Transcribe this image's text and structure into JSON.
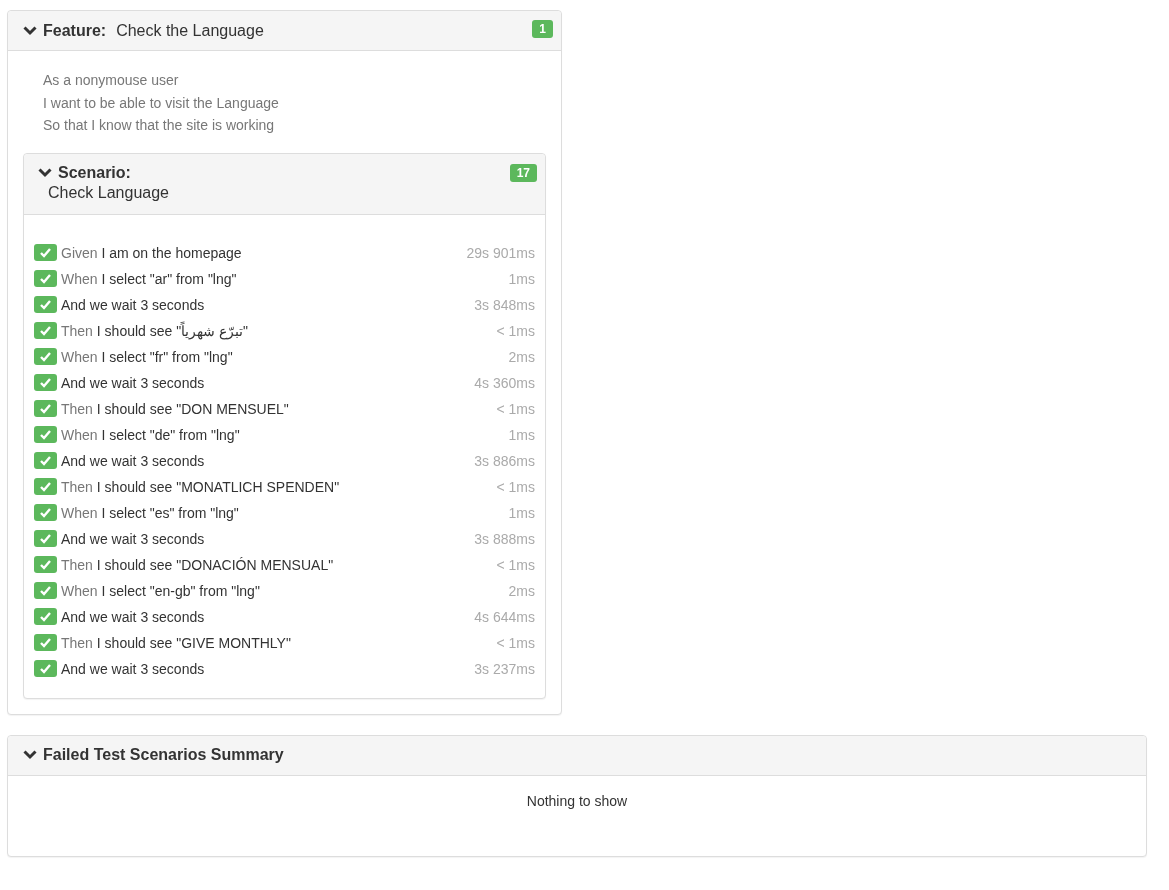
{
  "feature": {
    "label": "Feature:",
    "title": "Check the Language",
    "expanded": true,
    "count": "1",
    "description": [
      "As a nonymouse user",
      "I want to be able to visit the Language",
      "So that I know that the site is working"
    ],
    "scenario": {
      "label": "Scenario:",
      "title": "Check Language",
      "expanded": true,
      "count": "17",
      "steps": [
        {
          "kind": "given",
          "passed": true,
          "keyword": "Given",
          "text": "I am on the homepage",
          "duration": "29s 901ms"
        },
        {
          "kind": "when",
          "passed": true,
          "keyword": "When",
          "text": "I select \"ar\" from \"lng\"",
          "duration": "1ms"
        },
        {
          "kind": "and",
          "passed": true,
          "keyword": "And",
          "text": "we wait 3 seconds",
          "duration": "3s 848ms"
        },
        {
          "kind": "then",
          "passed": true,
          "keyword": "Then",
          "text": "I should see \"تبرّع شهرياً\"",
          "duration": "< 1ms"
        },
        {
          "kind": "when",
          "passed": true,
          "keyword": "When",
          "text": "I select \"fr\" from \"lng\"",
          "duration": "2ms"
        },
        {
          "kind": "and",
          "passed": true,
          "keyword": "And",
          "text": "we wait 3 seconds",
          "duration": "4s 360ms"
        },
        {
          "kind": "then",
          "passed": true,
          "keyword": "Then",
          "text": "I should see \"DON MENSUEL\"",
          "duration": "< 1ms"
        },
        {
          "kind": "when",
          "passed": true,
          "keyword": "When",
          "text": "I select \"de\" from \"lng\"",
          "duration": "1ms"
        },
        {
          "kind": "and",
          "passed": true,
          "keyword": "And",
          "text": "we wait 3 seconds",
          "duration": "3s 886ms"
        },
        {
          "kind": "then",
          "passed": true,
          "keyword": "Then",
          "text": "I should see \"MONATLICH SPENDEN\"",
          "duration": "< 1ms"
        },
        {
          "kind": "when",
          "passed": true,
          "keyword": "When",
          "text": "I select \"es\" from \"lng\"",
          "duration": "1ms"
        },
        {
          "kind": "and",
          "passed": true,
          "keyword": "And",
          "text": "we wait 3 seconds",
          "duration": "3s 888ms"
        },
        {
          "kind": "then",
          "passed": true,
          "keyword": "Then",
          "text": "I should see \"DONACIÓN MENSUAL\"",
          "duration": "< 1ms"
        },
        {
          "kind": "when",
          "passed": true,
          "keyword": "When",
          "text": "I select \"en-gb\" from \"lng\"",
          "duration": "2ms"
        },
        {
          "kind": "and",
          "passed": true,
          "keyword": "And",
          "text": "we wait 3 seconds",
          "duration": "4s 644ms"
        },
        {
          "kind": "then",
          "passed": true,
          "keyword": "Then",
          "text": "I should see \"GIVE MONTHLY\"",
          "duration": "< 1ms"
        },
        {
          "kind": "and",
          "passed": true,
          "keyword": "And",
          "text": "we wait 3 seconds",
          "duration": "3s 237ms"
        }
      ]
    }
  },
  "failed_summary": {
    "title": "Failed Test Scenarios Summary",
    "expanded": true,
    "message": "Nothing to show"
  }
}
